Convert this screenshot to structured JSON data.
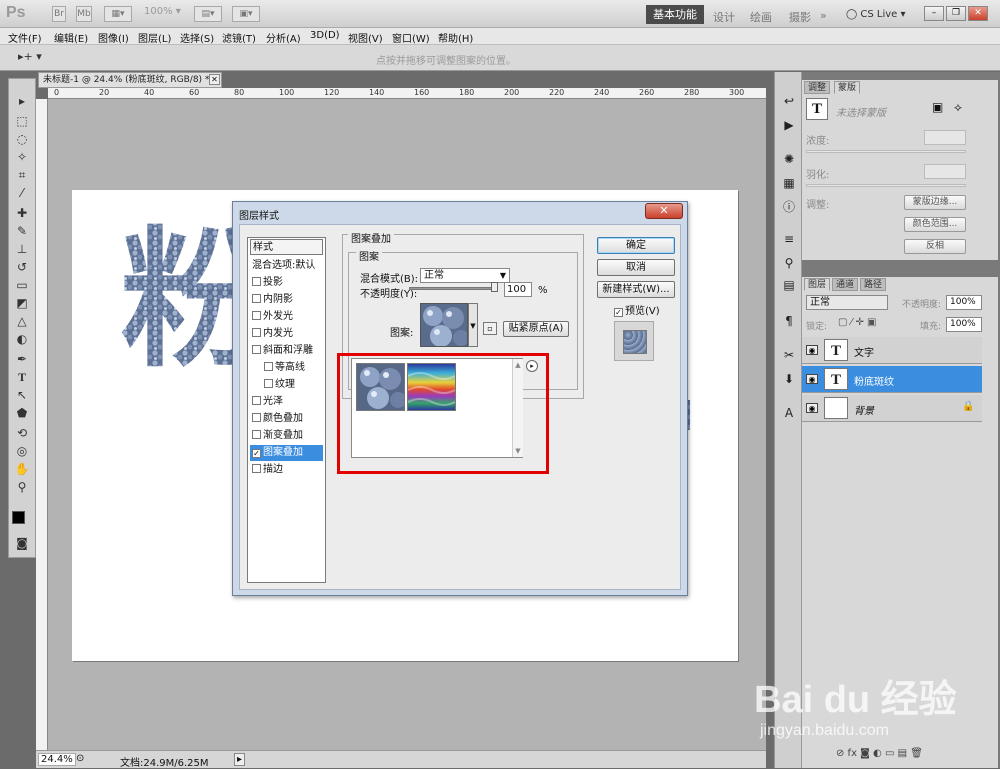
{
  "app": {
    "logo": "Ps",
    "zoom": "100%"
  },
  "workspaces": {
    "active": "基本功能",
    "items": [
      "设计",
      "绘画",
      "摄影",
      "»"
    ]
  },
  "cslive": "CS Live ▾",
  "menu": [
    "文件(F)",
    "编辑(E)",
    "图像(I)",
    "图层(L)",
    "选择(S)",
    "滤镜(T)",
    "分析(A)",
    "3D(D)",
    "视图(V)",
    "窗口(W)",
    "帮助(H)"
  ],
  "options": {
    "hint": "点按并拖移可调整图案的位置。"
  },
  "document": {
    "tab": "未标题-1 @ 24.4% (粉底斑纹, RGB/8) *",
    "zoom": "24.4%",
    "doc_info": "文档:24.9M/6.25M",
    "canvas_text": "粉",
    "ruler_top": [
      "0",
      "20",
      "40",
      "60",
      "80",
      "100",
      "120",
      "140",
      "160",
      "180",
      "200",
      "220",
      "240",
      "260",
      "280",
      "300"
    ]
  },
  "dialog": {
    "title": "图层样式",
    "styles_header": "样式",
    "styles": [
      {
        "label": "混合选项:默认",
        "checkbox": false,
        "checked": false
      },
      {
        "label": "投影",
        "checkbox": true,
        "checked": false
      },
      {
        "label": "内阴影",
        "checkbox": true,
        "checked": false
      },
      {
        "label": "外发光",
        "checkbox": true,
        "checked": false
      },
      {
        "label": "内发光",
        "checkbox": true,
        "checked": false
      },
      {
        "label": "斜面和浮雕",
        "checkbox": true,
        "checked": false
      },
      {
        "label": "等高线",
        "checkbox": true,
        "checked": false
      },
      {
        "label": "纹理",
        "checkbox": true,
        "checked": false
      },
      {
        "label": "光泽",
        "checkbox": true,
        "checked": false
      },
      {
        "label": "颜色叠加",
        "checkbox": true,
        "checked": false
      },
      {
        "label": "渐变叠加",
        "checkbox": true,
        "checked": false
      },
      {
        "label": "图案叠加",
        "checkbox": true,
        "checked": true
      },
      {
        "label": "描边",
        "checkbox": true,
        "checked": false
      }
    ],
    "group_outer": "图案叠加",
    "group_inner": "图案",
    "blend_label": "混合模式(B):",
    "blend_value": "正常",
    "opacity_label": "不透明度(Y):",
    "opacity_value": "100",
    "opacity_unit": "%",
    "pattern_label": "图案:",
    "snap_label": "贴紧原点(A)",
    "ok": "确定",
    "cancel": "取消",
    "new_style": "新建样式(W)...",
    "preview": "预览(V)",
    "preview_checked": true
  },
  "right_panels": {
    "top_tabs": [
      "调整",
      "蒙版"
    ],
    "mask_title": "未选择蒙版",
    "density": "浓度:",
    "feather": "羽化:",
    "refine": "调整:",
    "btn_mask_edge": "蒙版边缘...",
    "btn_color_range": "颜色范围...",
    "btn_invert": "反相",
    "layer_tabs": [
      "图层",
      "通道",
      "路径"
    ],
    "blend": "正常",
    "opacity_label": "不透明度:",
    "opacity": "100%",
    "lock_label": "锁定:",
    "fill_label": "填充:",
    "fill": "100%",
    "layers": [
      {
        "name": "文字",
        "thumb": "T",
        "selected": false
      },
      {
        "name": "粉底斑纹",
        "thumb": "T",
        "selected": true
      },
      {
        "name": "背景",
        "thumb": "",
        "selected": false
      }
    ]
  },
  "watermark": {
    "brand": "Bai du 经验",
    "url": "jingyan.baidu.com"
  },
  "colors": {
    "highlight": "#e30000",
    "selection": "#3b8de0",
    "ws_active": "#4b4b4b"
  }
}
